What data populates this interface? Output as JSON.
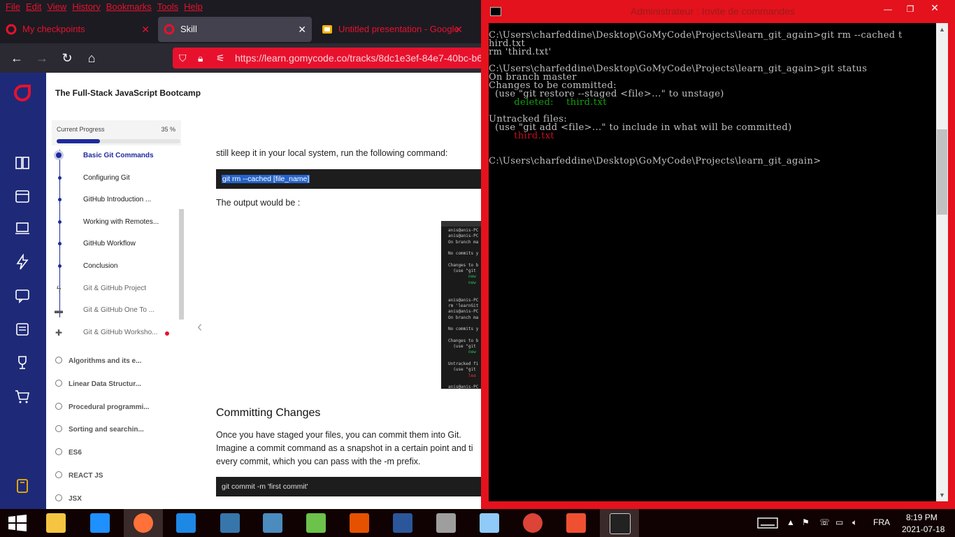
{
  "browser": {
    "menu": [
      "File",
      "Edit",
      "View",
      "History",
      "Bookmarks",
      "Tools",
      "Help"
    ],
    "tabs": [
      {
        "label": "My checkpoints",
        "icon": "gomycode-icon"
      },
      {
        "label": "Skill",
        "icon": "gomycode-icon",
        "active": true
      },
      {
        "label": "Untitled presentation - Google",
        "icon": "slides-icon"
      }
    ],
    "url": "https://learn.gomycode.co/tracks/8dc1e3ef-84e7-40bc-b6"
  },
  "course": {
    "title": "The Full-Stack JavaScript Bootcamp",
    "progress_label": "Current Progress",
    "progress_value": "35 %",
    "progress_fraction": 0.35
  },
  "lessons": [
    {
      "label": "Basic Git Commands",
      "state": "active"
    },
    {
      "label": "Configuring Git",
      "state": "done"
    },
    {
      "label": "GitHub Introduction ...",
      "state": "done"
    },
    {
      "label": "Working with Remotes...",
      "state": "done"
    },
    {
      "label": "GitHub Workflow",
      "state": "done"
    },
    {
      "label": "Conclusion",
      "state": "done"
    },
    {
      "label": "Git & GitHub Project",
      "state": "project",
      "icon": "bolt-icon"
    },
    {
      "label": "Git & GitHub One To ...",
      "state": "project",
      "icon": "chat-icon"
    },
    {
      "label": "Git & GitHub Worksho...",
      "state": "project",
      "icon": "puzzle-icon",
      "badge": "#e8112d"
    }
  ],
  "modules": [
    "Algorithms and its e...",
    "Linear Data Structur...",
    "Procedural programmi...",
    "Sorting and searchin...",
    "ES6",
    "REACT JS",
    "JSX"
  ],
  "content": {
    "intro_line": "still keep it in your local system, run the following command:",
    "code1": "git rm --cached [file_name]",
    "output_label": "The output would be :",
    "screenshot_lines": [
      {
        "t": "anis@anis-PC",
        "c": ""
      },
      {
        "t": "anis@anis-PC",
        "c": ""
      },
      {
        "t": "On branch ma",
        "c": ""
      },
      {
        "t": "",
        "c": ""
      },
      {
        "t": "No commits y",
        "c": ""
      },
      {
        "t": "",
        "c": ""
      },
      {
        "t": "Changes to b",
        "c": ""
      },
      {
        "t": "  (use \"git",
        "c": ""
      },
      {
        "t": "        new",
        "c": "g"
      },
      {
        "t": "        new",
        "c": "g"
      },
      {
        "t": "",
        "c": ""
      },
      {
        "t": "",
        "c": ""
      },
      {
        "t": "anis@anis-PC",
        "c": ""
      },
      {
        "t": "rm 'learnGit",
        "c": ""
      },
      {
        "t": "anis@anis-PC",
        "c": ""
      },
      {
        "t": "On branch ma",
        "c": ""
      },
      {
        "t": "",
        "c": ""
      },
      {
        "t": "No commits y",
        "c": ""
      },
      {
        "t": "",
        "c": ""
      },
      {
        "t": "Changes to b",
        "c": ""
      },
      {
        "t": "  (use \"git",
        "c": ""
      },
      {
        "t": "        new",
        "c": "g"
      },
      {
        "t": "",
        "c": ""
      },
      {
        "t": "Untracked fi",
        "c": ""
      },
      {
        "t": "  (use \"git",
        "c": ""
      },
      {
        "t": "        lea",
        "c": "r"
      },
      {
        "t": "",
        "c": ""
      },
      {
        "t": "anis@anis-PC",
        "c": ""
      }
    ],
    "heading": "Committing Changes",
    "para1": "Once you have staged your files, you can commit them into Git.",
    "para2": "Imagine a commit command as a snapshot in a certain point and ti",
    "para3": "every commit, which you can pass with the -m prefix.",
    "code2": "git commit -m 'first commit'"
  },
  "cmd": {
    "title": "Administrateur : Invite de commandes",
    "lines": [
      {
        "t": "C:\\Users\\charfeddine\\Desktop\\GoMyCode\\Projects\\learn_git_again>git rm --cached t",
        "c": ""
      },
      {
        "t": "hird.txt",
        "c": ""
      },
      {
        "t": "rm 'third.txt'",
        "c": ""
      },
      {
        "t": "",
        "c": ""
      },
      {
        "t": "C:\\Users\\charfeddine\\Desktop\\GoMyCode\\Projects\\learn_git_again>git status",
        "c": ""
      },
      {
        "t": "On branch master",
        "c": ""
      },
      {
        "t": "Changes to be committed:",
        "c": ""
      },
      {
        "t": "  (use \"git restore --staged <file>...\" to unstage)",
        "c": ""
      },
      {
        "t": "        deleted:    third.txt",
        "c": "g"
      },
      {
        "t": "",
        "c": ""
      },
      {
        "t": "Untracked files:",
        "c": ""
      },
      {
        "t": "  (use \"git add <file>...\" to include in what will be committed)",
        "c": ""
      },
      {
        "t": "        third.txt",
        "c": "r"
      },
      {
        "t": "",
        "c": ""
      },
      {
        "t": "",
        "c": ""
      },
      {
        "t": "C:\\Users\\charfeddine\\Desktop\\GoMyCode\\Projects\\learn_git_again>",
        "c": ""
      }
    ]
  },
  "taskbar": {
    "apps": [
      "file-explorer-icon",
      "internet-explorer-icon",
      "firefox-icon",
      "vscode-icon",
      "python-icon",
      "python-idle-icon",
      "node-icon",
      "brackets-icon",
      "word-icon",
      "wamp-icon",
      "notepad-icon",
      "chrome-icon",
      "git-icon",
      "cmd-icon"
    ],
    "language": "FRA",
    "time": "8:19 PM",
    "date": "2021-07-18"
  }
}
